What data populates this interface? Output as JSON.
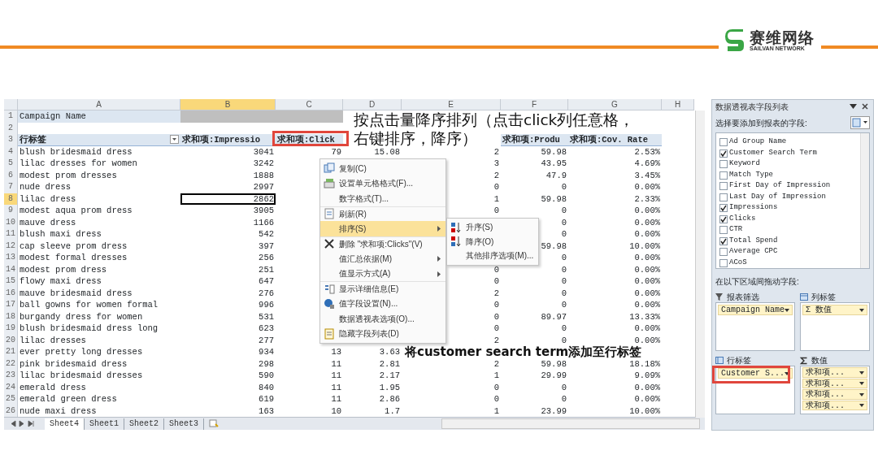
{
  "logo": {
    "name": "赛维网络",
    "subtitle": "SAILVAN NETWORK"
  },
  "sheet": {
    "columns": [
      {
        "label": "A",
        "selected": false
      },
      {
        "label": "B",
        "selected": true
      },
      {
        "label": "C",
        "selected": false
      },
      {
        "label": "D",
        "selected": false
      },
      {
        "label": "E",
        "selected": false
      },
      {
        "label": "F",
        "selected": false
      },
      {
        "label": "G",
        "selected": false
      },
      {
        "label": "H",
        "selected": false
      }
    ],
    "rows": [
      {
        "number": "1",
        "kind": "filter",
        "selected": false,
        "cells": [
          "Campaign Name"
        ]
      },
      {
        "number": "2",
        "kind": "blank",
        "selected": false,
        "cells": []
      },
      {
        "number": "3",
        "kind": "header",
        "selected": false,
        "cells": [
          "行标签",
          "求和项:Impressio",
          "求和项:Click",
          null,
          null,
          "求和项:Produ",
          "求和项:Cov. Rate"
        ]
      },
      {
        "number": "4",
        "kind": "data",
        "selected": false,
        "cells": [
          "blush bridesmaid dress",
          "3041",
          "79",
          "15.08",
          "2",
          "59.98",
          "2.53%"
        ]
      },
      {
        "number": "5",
        "kind": "data",
        "selected": false,
        "cells": [
          "lilac dresses for women",
          "3242",
          null,
          null,
          "3",
          "43.95",
          "4.69%"
        ]
      },
      {
        "number": "6",
        "kind": "data",
        "selected": false,
        "cells": [
          "modest prom dresses",
          "1888",
          null,
          null,
          "2",
          "47.9",
          "3.45%"
        ]
      },
      {
        "number": "7",
        "kind": "data",
        "selected": false,
        "cells": [
          "nude dress",
          "2997",
          null,
          null,
          "0",
          "0",
          "0.00%"
        ]
      },
      {
        "number": "8",
        "kind": "data",
        "selected": true,
        "cells": [
          "lilac dress",
          "2862",
          null,
          null,
          "1",
          "59.98",
          "2.33%"
        ]
      },
      {
        "number": "9",
        "kind": "data",
        "selected": false,
        "cells": [
          "modest aqua prom dress",
          "3905",
          null,
          null,
          "0",
          "0",
          "0.00%"
        ]
      },
      {
        "number": "10",
        "kind": "data",
        "selected": false,
        "cells": [
          "mauve dress",
          "1166",
          null,
          null,
          null,
          "0",
          "0.00%"
        ]
      },
      {
        "number": "11",
        "kind": "data",
        "selected": false,
        "cells": [
          "blush maxi dress",
          "542",
          null,
          null,
          null,
          "0",
          "0.00%"
        ]
      },
      {
        "number": "12",
        "kind": "data",
        "selected": false,
        "cells": [
          "cap sleeve prom dress",
          "397",
          null,
          null,
          null,
          "59.98",
          "10.00%"
        ]
      },
      {
        "number": "13",
        "kind": "data",
        "selected": false,
        "cells": [
          "modest formal dresses",
          "256",
          null,
          null,
          null,
          "0",
          "0.00%"
        ]
      },
      {
        "number": "14",
        "kind": "data",
        "selected": false,
        "cells": [
          "modest prom dress",
          "251",
          null,
          null,
          "0",
          "0",
          "0.00%"
        ]
      },
      {
        "number": "15",
        "kind": "data",
        "selected": false,
        "cells": [
          "flowy maxi dress",
          "647",
          null,
          null,
          "0",
          "0",
          "0.00%"
        ]
      },
      {
        "number": "16",
        "kind": "data",
        "selected": false,
        "cells": [
          "mauve bridesmaid dress",
          "276",
          null,
          null,
          "2",
          "0",
          "0.00%"
        ]
      },
      {
        "number": "17",
        "kind": "data",
        "selected": false,
        "cells": [
          "ball gowns for women formal",
          "996",
          null,
          null,
          "0",
          "0",
          "0.00%"
        ]
      },
      {
        "number": "18",
        "kind": "data",
        "selected": false,
        "cells": [
          "burgandy dress for women",
          "531",
          null,
          null,
          "0",
          "89.97",
          "13.33%"
        ]
      },
      {
        "number": "19",
        "kind": "data",
        "selected": false,
        "cells": [
          "blush bridesmaid dress long",
          "623",
          null,
          null,
          "0",
          "0",
          "0.00%"
        ]
      },
      {
        "number": "20",
        "kind": "data",
        "selected": false,
        "cells": [
          "lilac dresses",
          "277",
          null,
          null,
          "2",
          "0",
          "0.00%"
        ]
      },
      {
        "number": "21",
        "kind": "data",
        "selected": false,
        "cells": [
          "ever pretty long dresses",
          "934",
          "13",
          "3.63",
          null,
          null,
          null
        ]
      },
      {
        "number": "22",
        "kind": "data",
        "selected": false,
        "cells": [
          "pink bridesmaid dress",
          "298",
          "11",
          "2.81",
          "2",
          "59.98",
          "18.18%"
        ]
      },
      {
        "number": "23",
        "kind": "data",
        "selected": false,
        "cells": [
          "lilac bridesmaid dresses",
          "590",
          "11",
          "2.17",
          "1",
          "29.99",
          "9.09%"
        ]
      },
      {
        "number": "24",
        "kind": "data",
        "selected": false,
        "cells": [
          "emerald dress",
          "840",
          "11",
          "1.95",
          "0",
          "0",
          "0.00%"
        ]
      },
      {
        "number": "25",
        "kind": "data",
        "selected": false,
        "cells": [
          "emerald green dress",
          "619",
          "11",
          "2.86",
          "0",
          "0",
          "0.00%"
        ]
      },
      {
        "number": "26",
        "kind": "data",
        "selected": false,
        "cells": [
          "nude maxi dress",
          "163",
          "10",
          "1.7",
          "1",
          "23.99",
          "10.00%"
        ]
      }
    ],
    "tabs": [
      {
        "label": "Sheet4",
        "selected": true
      },
      {
        "label": "Sheet1",
        "selected": false
      },
      {
        "label": "Sheet2",
        "selected": false
      },
      {
        "label": "Sheet3",
        "selected": false
      }
    ]
  },
  "context_menu": {
    "items": [
      {
        "label": "复制(C)",
        "kind": "copy",
        "selected": false,
        "submenu": false
      },
      {
        "label": "设置单元格格式(F)...",
        "kind": "format",
        "selected": false,
        "submenu": false
      },
      {
        "label": "数字格式(T)...",
        "kind": "plain",
        "selected": false,
        "submenu": false
      },
      {
        "label": "刷新(R)",
        "kind": "refresh",
        "selected": false,
        "submenu": false
      },
      {
        "label": "排序(S)",
        "kind": "plain",
        "selected": true,
        "submenu": true
      },
      {
        "label": "删除 \"求和项:Clicks\"(V)",
        "kind": "delete",
        "selected": false,
        "submenu": false
      },
      {
        "label": "值汇总依据(M)",
        "kind": "plain",
        "selected": false,
        "submenu": true
      },
      {
        "label": "值显示方式(A)",
        "kind": "plain",
        "selected": false,
        "submenu": true
      },
      {
        "label": "显示详细信息(E)",
        "kind": "details",
        "selected": false,
        "submenu": false
      },
      {
        "label": "值字段设置(N)...",
        "kind": "settings",
        "selected": false,
        "submenu": false
      },
      {
        "label": "数据透视表选项(O)...",
        "kind": "plain",
        "selected": false,
        "submenu": false
      },
      {
        "label": "隐藏字段列表(D)",
        "kind": "fieldlist",
        "selected": false,
        "submenu": false
      }
    ],
    "submenu": [
      {
        "label": "升序(S)",
        "kind": "ascending"
      },
      {
        "label": "降序(O)",
        "kind": "descending"
      },
      {
        "label": "其他排序选项(M)...",
        "kind": "plain"
      }
    ]
  },
  "annotations": [
    {
      "text": "按点击量降序排列（点击click列任意格，",
      "kind": "plain"
    },
    {
      "text": "右键排序，降序）",
      "kind": "plain"
    },
    {
      "text": "将customer search term添加至行标签",
      "kind": "bold"
    }
  ],
  "field_list": {
    "title": "数据透视表字段列表",
    "prompt": "选择要添加到报表的字段:",
    "fields": [
      {
        "label": "Ad Group Name",
        "checked": false
      },
      {
        "label": "Customer Search Term",
        "checked": true
      },
      {
        "label": "Keyword",
        "checked": false
      },
      {
        "label": "Match Type",
        "checked": false
      },
      {
        "label": "First Day of Impression",
        "checked": false
      },
      {
        "label": "Last Day of Impression",
        "checked": false
      },
      {
        "label": "Impressions",
        "checked": true
      },
      {
        "label": "Clicks",
        "checked": true
      },
      {
        "label": "CTR",
        "checked": false
      },
      {
        "label": "Total Spend",
        "checked": true
      },
      {
        "label": "Average CPC",
        "checked": false
      },
      {
        "label": "ACoS",
        "checked": false
      }
    ],
    "areas_prompt": "在以下区域间拖动字段:",
    "areas": [
      {
        "title": "报表筛选",
        "kind": "filter",
        "items": [
          "Campaign Name"
        ]
      },
      {
        "title": "列标签",
        "kind": "columns",
        "items": [
          "Σ 数值"
        ]
      },
      {
        "title": "行标签",
        "kind": "rows",
        "items": [
          "Customer S..."
        ]
      },
      {
        "title": "数值",
        "kind": "values",
        "items": [
          "求和项...",
          "求和项...",
          "求和项...",
          "求和项..."
        ]
      }
    ]
  }
}
